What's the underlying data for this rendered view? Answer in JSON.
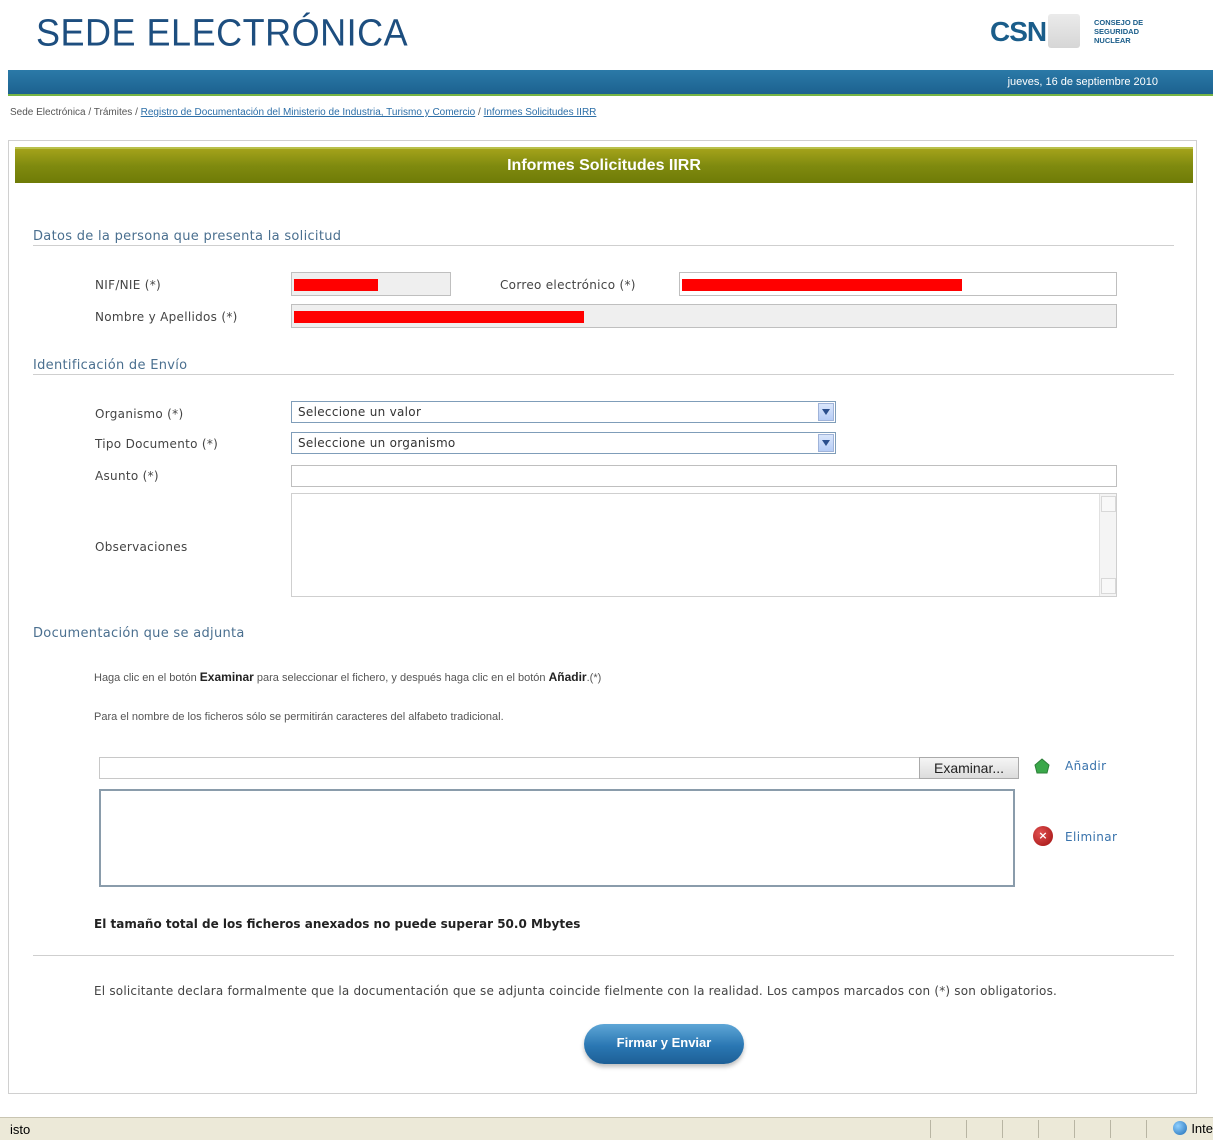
{
  "header": {
    "title": "SEDE ELECTRÓNICA",
    "logo_text": "CSN",
    "logo_sub_1": "CONSEJO DE",
    "logo_sub_2": "SEGURIDAD NUCLEAR",
    "date": "jueves, 16 de septiembre 2010",
    "colors": {
      "title": "#1d4e7f",
      "topbar": "#1c628f",
      "accent_line": "#76b445"
    }
  },
  "breadcrumb": {
    "items": [
      "Sede Electrónica",
      "Trámites",
      "Registro de Documentación del Ministerio de Industria, Turismo y Comercio",
      "Informes Solicitudes IIRR"
    ],
    "separator": " / "
  },
  "panel": {
    "title": "Informes Solicitudes IIRR",
    "color": "#7f8a0f"
  },
  "sections": {
    "person": {
      "title": "Datos de la persona que presenta la solicitud",
      "nif_label": "NIF/NIE (*)",
      "email_label": "Correo electrónico (*)",
      "name_label": "Nombre y Apellidos (*)"
    },
    "envio": {
      "title": "Identificación de Envío",
      "organismo_label": "Organismo (*)",
      "organismo_value": "Seleccione un valor",
      "tipo_label": "Tipo Documento (*)",
      "tipo_value": "Seleccione un organismo",
      "asunto_label": "Asunto (*)",
      "observaciones_label": "Observaciones"
    },
    "docs": {
      "title": "Documentación que se adjunta",
      "instr_prefix": "Haga clic en el botón",
      "instr_btn1": "Examinar",
      "instr_mid": "para seleccionar el fichero, y después haga clic en el botón",
      "instr_btn2": "Añadir",
      "instr_suffix": ".(*)",
      "chars_note": "Para el nombre de los ficheros sólo se permitirán caracteres del alfabeto tradicional.",
      "browse_label": "Examinar...",
      "add_label": "Añadir",
      "remove_label": "Eliminar",
      "size_note": "El tamaño total de los ficheros anexados no puede superar 50.0 Mbytes",
      "declaration": "El solicitante declara formalmente que la documentación que se adjunta coincide fielmente con la realidad. Los campos marcados con (*) son obligatorios.",
      "submit_label": "Firmar y Enviar"
    }
  },
  "statusbar": {
    "left": "isto",
    "zone": "Inte"
  }
}
